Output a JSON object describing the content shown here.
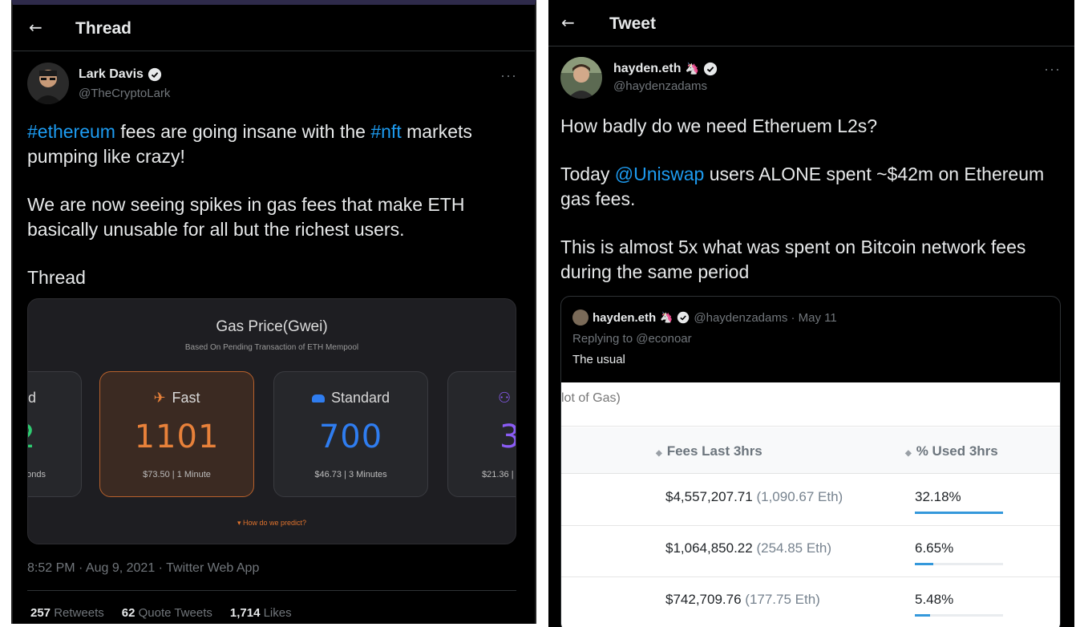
{
  "left": {
    "header": {
      "title": "Thread"
    },
    "author": {
      "name": "Lark Davis",
      "handle": "@TheCryptoLark"
    },
    "tweet": {
      "p1_tag1": "#ethereum",
      "p1_mid": " fees are going insane with the ",
      "p1_tag2": "#nft",
      "p1_end": " markets pumping like crazy!",
      "p2": "We are now seeing spikes in gas fees that make ETH basically unusable for all but the richest users.",
      "p3": "Thread"
    },
    "gas_card": {
      "title": "Gas Price(Gwei)",
      "subtitle": "Based On Pending Transaction of ETH Mempool",
      "tiles": [
        {
          "label": "d",
          "value": "2",
          "foot": "onds",
          "color": "#2ecc71"
        },
        {
          "label": "Fast",
          "value": "1101",
          "foot": "$73.50 | 1 Minute",
          "color": "#e8813a"
        },
        {
          "label": "Standard",
          "value": "700",
          "foot": "$46.73 | 3 Minutes",
          "color": "#2f7df0"
        },
        {
          "label": "",
          "value": "3",
          "foot": "$21.36 |",
          "color": "#8b5cf6"
        }
      ],
      "predict": "▾ How do we predict?"
    },
    "meta": "8:52 PM · Aug 9, 2021 · Twitter Web App",
    "stats": {
      "retweets_count": "257",
      "retweets_label": "Retweets",
      "quotes_count": "62",
      "quotes_label": "Quote Tweets",
      "likes_count": "1,714",
      "likes_label": "Likes"
    }
  },
  "right": {
    "header": {
      "title": "Tweet"
    },
    "author": {
      "name": "hayden.eth",
      "emoji": "🦄",
      "handle": "@haydenzadams"
    },
    "tweet": {
      "p1": "How badly do we need Etheruem L2s?",
      "p2_start": "Today ",
      "p2_mention": "@Uniswap",
      "p2_end": " users ALONE spent ~$42m on Ethereum gas fees.",
      "p3": "This is almost 5x what was spent on Bitcoin network fees during the same period"
    },
    "quote": {
      "name": "hayden.eth",
      "emoji": "🦄",
      "handle_date": "@haydenzadams · May 11",
      "reply": "Replying to @econoar",
      "text": "The usual",
      "table": {
        "topnote": "lot of Gas)",
        "col_fees": "Fees Last 3hrs",
        "col_pct": "% Used 3hrs",
        "rows": [
          {
            "usd": "$4,557,207.71",
            "eth": "(1,090.67 Eth)",
            "pct": "32.18%",
            "pct_value": 32.18
          },
          {
            "usd": "$1,064,850.22",
            "eth": "(254.85 Eth)",
            "pct": "6.65%",
            "pct_value": 6.65
          },
          {
            "usd": "$742,709.76",
            "eth": "(177.75 Eth)",
            "pct": "5.48%",
            "pct_value": 5.48
          }
        ]
      }
    }
  }
}
